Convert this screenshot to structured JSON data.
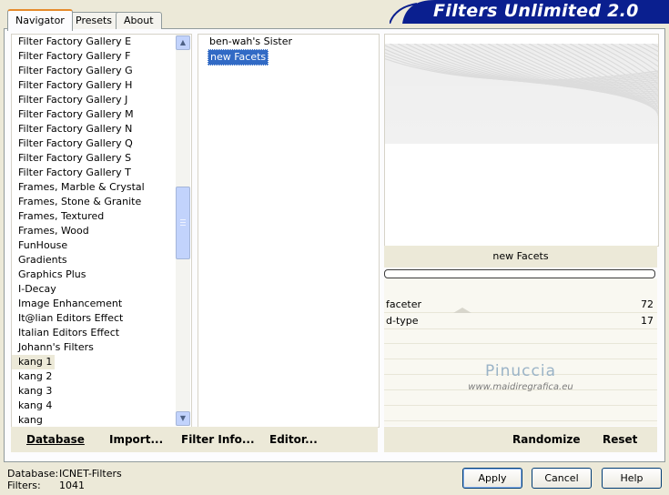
{
  "title": "Filters Unlimited 2.0",
  "tabs": [
    {
      "label": "Navigator",
      "active": true
    },
    {
      "label": "Presets",
      "active": false
    },
    {
      "label": "About",
      "active": false
    }
  ],
  "categories": [
    "Filter Factory Gallery E",
    "Filter Factory Gallery F",
    "Filter Factory Gallery G",
    "Filter Factory Gallery H",
    "Filter Factory Gallery J",
    "Filter Factory Gallery M",
    "Filter Factory Gallery N",
    "Filter Factory Gallery Q",
    "Filter Factory Gallery S",
    "Filter Factory Gallery T",
    "Frames, Marble & Crystal",
    "Frames, Stone & Granite",
    "Frames, Textured",
    "Frames, Wood",
    "FunHouse",
    "Gradients",
    "Graphics Plus",
    "I-Decay",
    "Image Enhancement",
    "It@lian Editors Effect",
    "Italian Editors Effect",
    "Johann's Filters",
    "kang 1",
    "kang 2",
    "kang 3",
    "kang 4",
    "kang"
  ],
  "selected_category": "kang 1",
  "filters": [
    "ben-wah's Sister",
    "new Facets"
  ],
  "selected_filter": "new Facets",
  "preview_title": "new Facets",
  "params": [
    {
      "label": "faceter",
      "value": "72"
    },
    {
      "label": "d-type",
      "value": "17"
    }
  ],
  "watermark": {
    "line1": "Pinuccia",
    "line2": "www.maidiregrafica.eu"
  },
  "toolbar": {
    "database": "Database",
    "import": "Import...",
    "filter_info": "Filter Info...",
    "editor": "Editor...",
    "randomize": "Randomize",
    "reset": "Reset"
  },
  "footer": {
    "database_label": "Database:",
    "database_value": "ICNET-Filters",
    "filters_label": "Filters:",
    "filters_value": "1041"
  },
  "buttons": {
    "apply": "Apply",
    "cancel": "Cancel",
    "help": "Help"
  },
  "colors": {
    "banner": "#0a1f8f",
    "selection": "#316ac5",
    "tab_accent": "#e68b2c"
  }
}
